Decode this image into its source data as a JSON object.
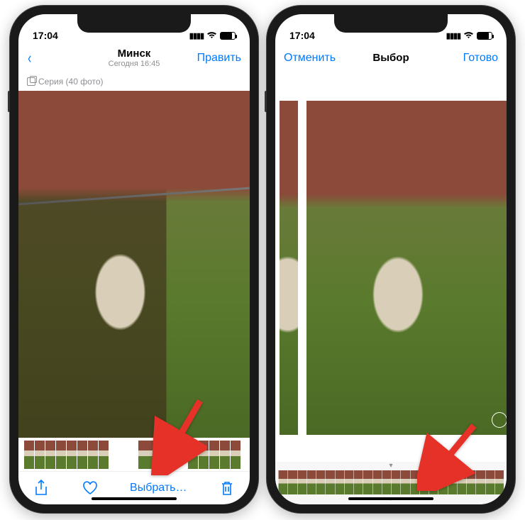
{
  "left": {
    "status": {
      "time": "17:04"
    },
    "nav": {
      "back_glyph": "‹",
      "title": "Минск",
      "subtitle": "Сегодня 16:45",
      "edit": "Править"
    },
    "meta": {
      "burst_label": "Серия (40 фото)"
    },
    "toolbar": {
      "select_label": "Выбрать…"
    }
  },
  "right": {
    "status": {
      "time": "17:04"
    },
    "nav": {
      "cancel": "Отменить",
      "title": "Выбор",
      "done": "Готово"
    }
  },
  "colors": {
    "ios_blue": "#007aff",
    "arrow_red": "#e53127"
  }
}
